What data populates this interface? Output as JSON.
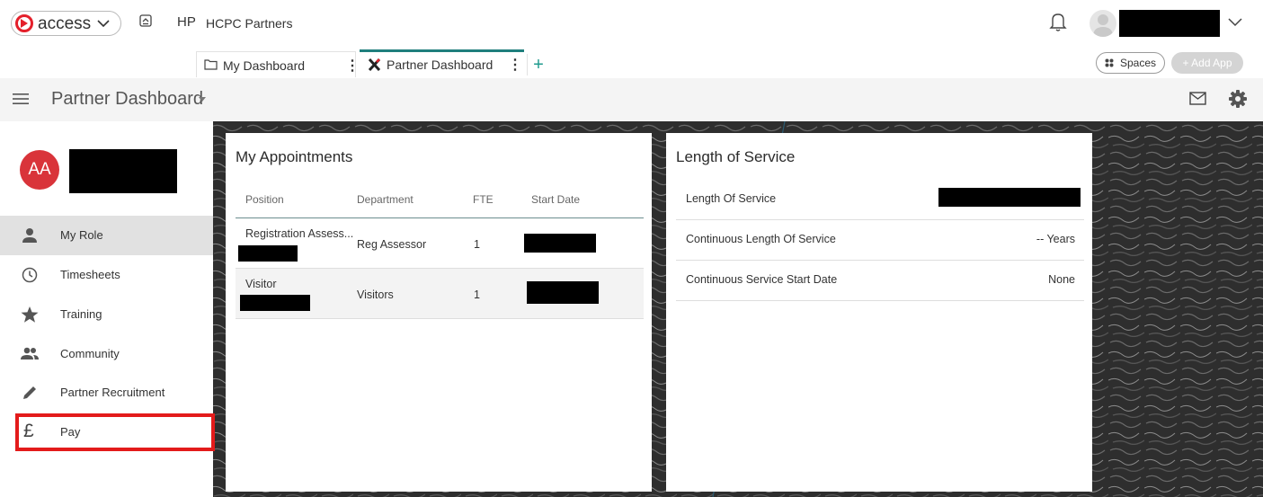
{
  "topbar": {
    "brand": "access",
    "org_initials": "HP",
    "org_name": "HCPC Partners"
  },
  "tabs": [
    {
      "label": "My Dashboard",
      "icon": "folder-icon"
    },
    {
      "label": "Partner Dashboard",
      "icon": "x-logo-icon",
      "active": true
    }
  ],
  "spaces_label": "Spaces",
  "add_app_label": "+ Add App",
  "page_title": "Partner Dashboard",
  "profile": {
    "initials": "AA"
  },
  "sidebar": {
    "items": [
      {
        "label": "My Role",
        "icon": "person-icon",
        "active": true
      },
      {
        "label": "Timesheets",
        "icon": "clock-icon"
      },
      {
        "label": "Training",
        "icon": "star-icon"
      },
      {
        "label": "Community",
        "icon": "people-icon"
      },
      {
        "label": "Partner Recruitment",
        "icon": "pencil-icon"
      },
      {
        "label": "Pay",
        "icon": "pound-icon",
        "highlighted": true
      }
    ]
  },
  "appointments": {
    "title": "My Appointments",
    "headers": [
      "Position",
      "Department",
      "FTE",
      "Start Date"
    ],
    "rows": [
      {
        "position": "Registration Assess...",
        "department": "Reg Assessor",
        "fte": "1"
      },
      {
        "position": "Visitor",
        "department": "Visitors",
        "fte": "1"
      }
    ]
  },
  "length_of_service": {
    "title": "Length of Service",
    "rows": [
      {
        "label": "Length Of Service",
        "value": ""
      },
      {
        "label": "Continuous Length Of Service",
        "value": "-- Years"
      },
      {
        "label": "Continuous Service Start Date",
        "value": "None"
      }
    ]
  },
  "colors": {
    "accent_teal": "#1f7f7d",
    "brand_red": "#e4202b",
    "avatar_red": "#d9343a",
    "highlight_red": "#e31b1b"
  }
}
